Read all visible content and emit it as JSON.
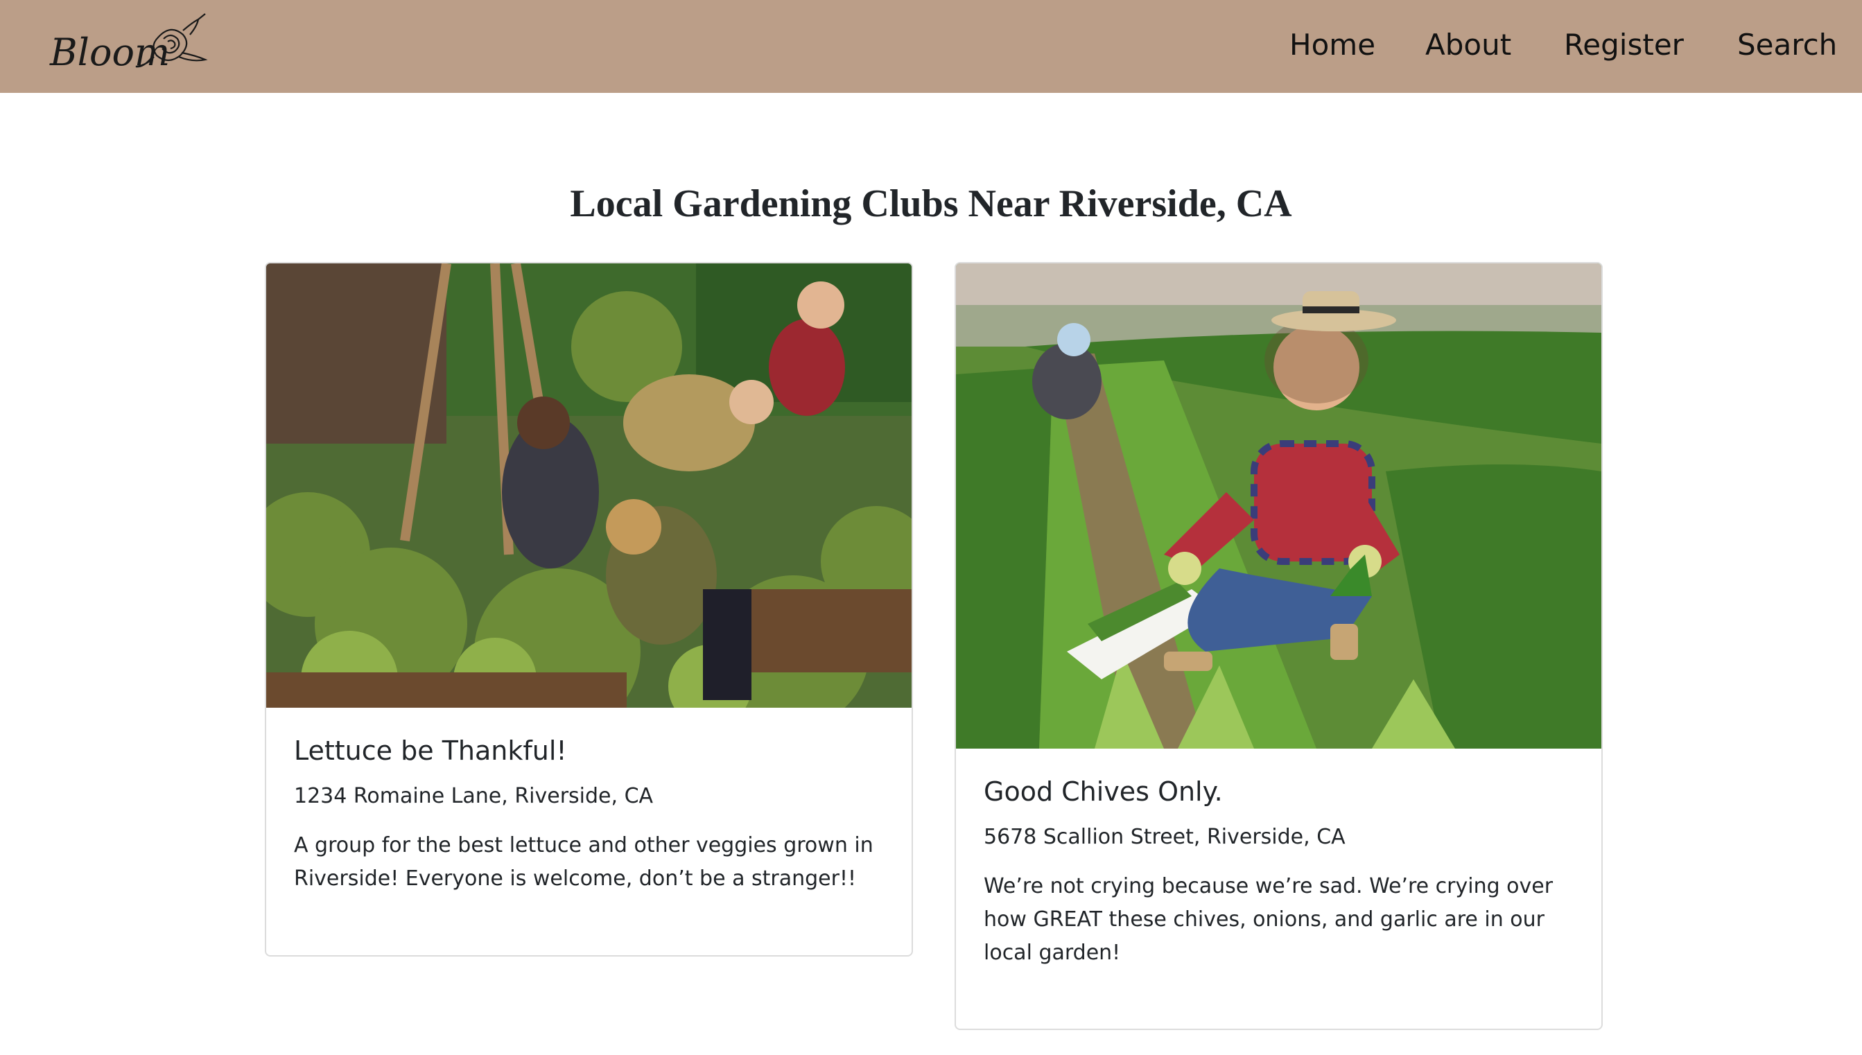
{
  "brand": {
    "logo_text": "Bloom"
  },
  "nav": {
    "links": [
      {
        "label": "Home"
      },
      {
        "label": "About"
      },
      {
        "label": "Register"
      },
      {
        "label": "Search"
      }
    ]
  },
  "page": {
    "title": "Local Gardening Clubs Near Riverside, CA"
  },
  "clubs": [
    {
      "name": "Lettuce be Thankful!",
      "address": "1234 Romaine Lane, Riverside, CA",
      "description": "A group for the best lettuce and other veggies grown in Riverside! Everyone is welcome, don’t be a stranger!!"
    },
    {
      "name": "Good Chives Only.",
      "address": "5678 Scallion Street, Riverside, CA",
      "description": "We’re not crying because we’re sad. We’re crying over how GREAT these chives, onions, and garlic are in our local garden!"
    }
  ],
  "colors": {
    "navbar": "#bb9e88",
    "text": "#212529",
    "card_border": "#dcdcdc"
  }
}
